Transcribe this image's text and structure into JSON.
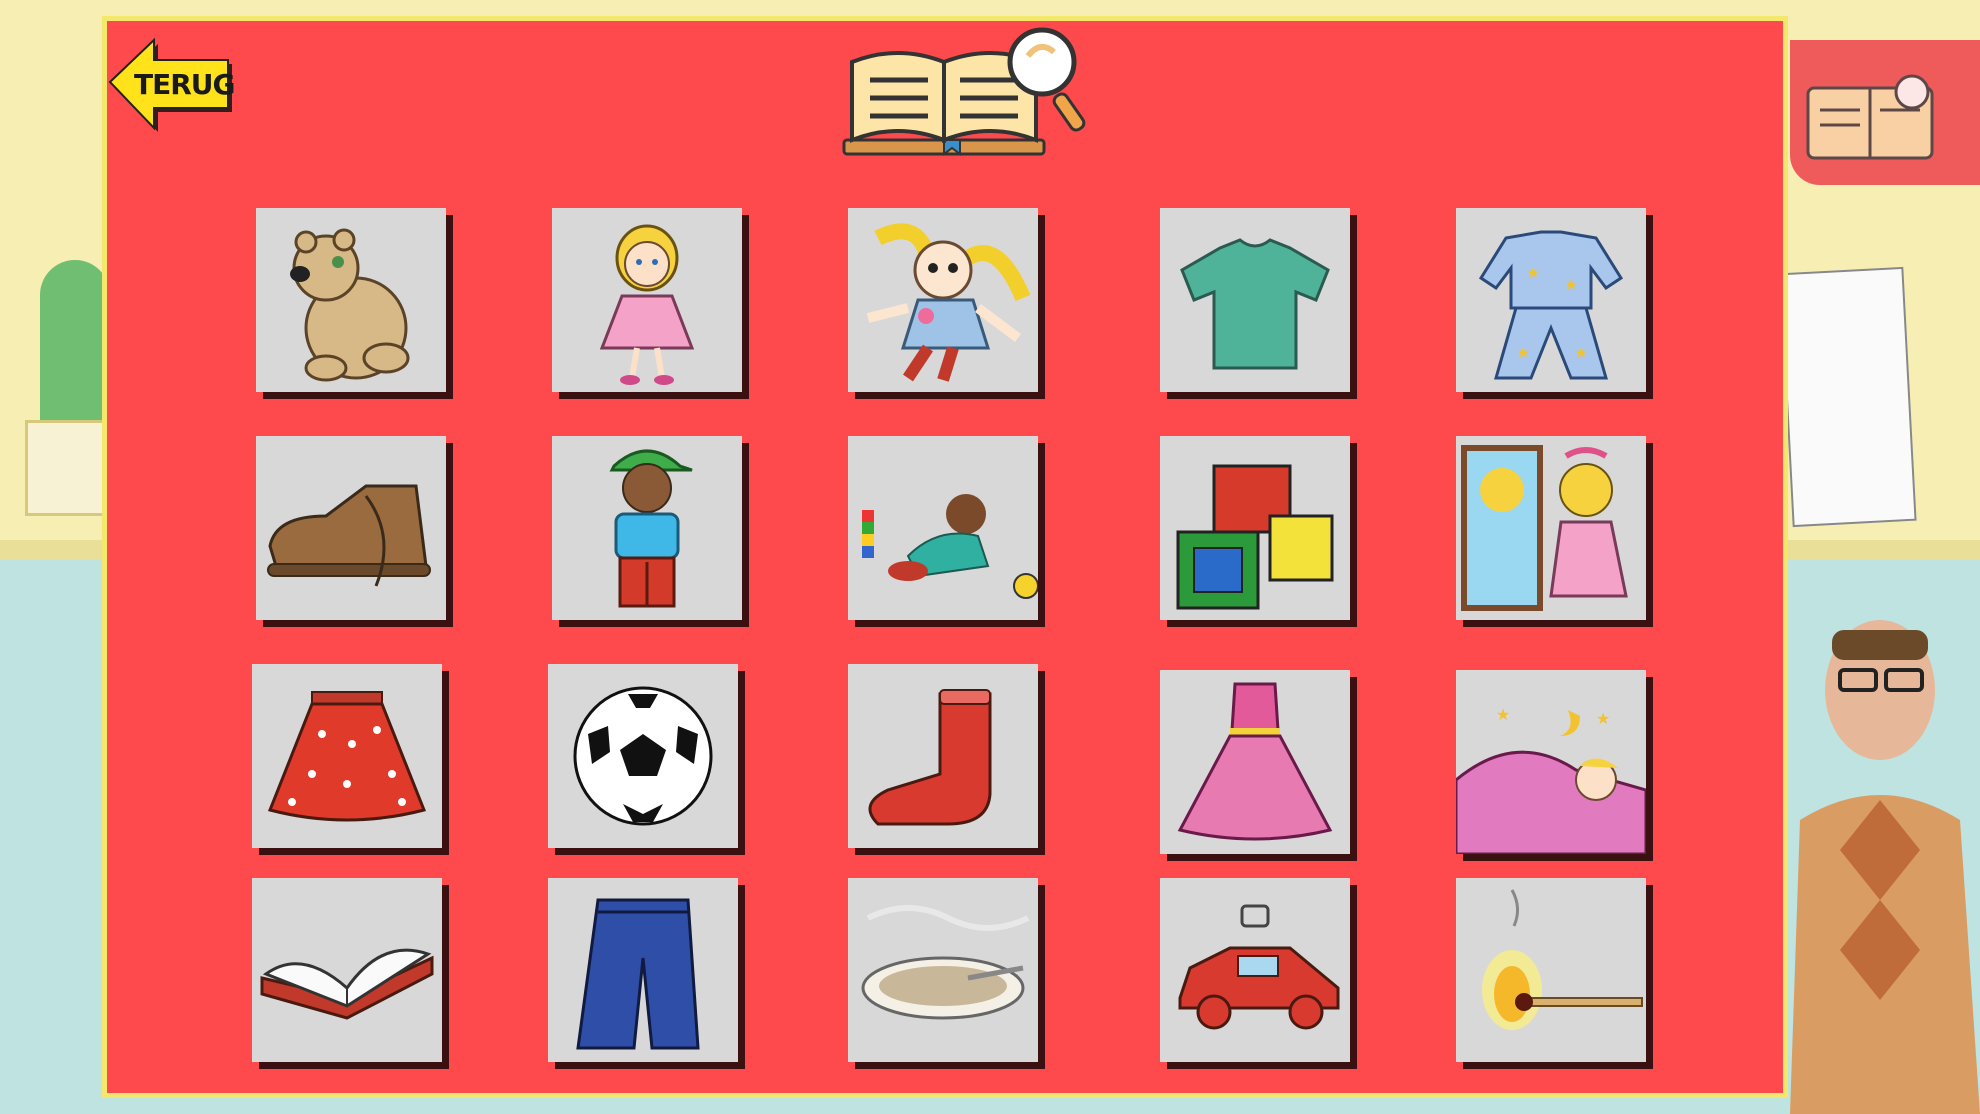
{
  "header": {
    "back_label": "TERUG",
    "title_icon": "book-magnifier-icon"
  },
  "tiles": [
    {
      "icon": "teddy-bear-icon"
    },
    {
      "icon": "girl-pink-dress-icon"
    },
    {
      "icon": "rag-doll-icon"
    },
    {
      "icon": "t-shirt-icon"
    },
    {
      "icon": "pajamas-icon"
    },
    {
      "icon": "shoe-icon"
    },
    {
      "icon": "boy-green-cap-icon"
    },
    {
      "icon": "boy-playing-blocks-icon"
    },
    {
      "icon": "toy-blocks-icon"
    },
    {
      "icon": "girl-mirror-icon"
    },
    {
      "icon": "polka-dot-skirt-icon"
    },
    {
      "icon": "soccer-ball-icon"
    },
    {
      "icon": "sock-icon"
    },
    {
      "icon": "pink-gown-icon"
    },
    {
      "icon": "girl-sleeping-icon"
    },
    {
      "icon": "open-book-icon"
    },
    {
      "icon": "jeans-icon"
    },
    {
      "icon": "porridge-bowl-icon"
    },
    {
      "icon": "toy-car-icon"
    },
    {
      "icon": "burning-match-icon"
    }
  ],
  "colors": {
    "board": "#ff4a4d",
    "board_border": "#f3e86b",
    "tile": "#d8d8d8",
    "tile_shadow": "#3a1010",
    "back_button": "#ffe21a"
  }
}
